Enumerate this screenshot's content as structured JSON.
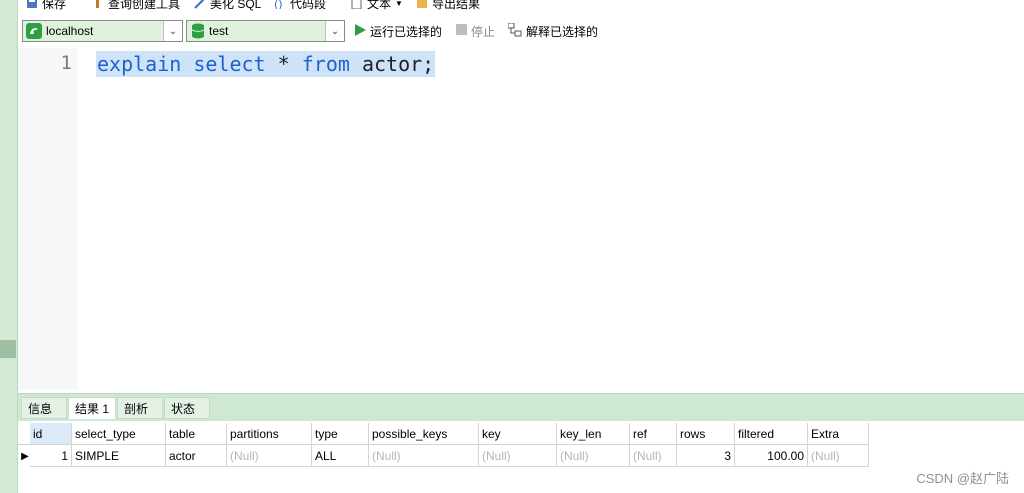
{
  "top_toolbar": {
    "save_label": "保存",
    "query_builder_label": "查询创建工具",
    "beautify_label": "美化 SQL",
    "snippet_label": "代码段",
    "text_label": "文本",
    "export_label": "导出结果"
  },
  "connection": {
    "value": "localhost",
    "icon": "mysql-connection-icon",
    "accent": "#2ea043"
  },
  "database": {
    "value": "test",
    "icon": "database-icon",
    "accent": "#2ea043"
  },
  "actions": {
    "run_selected": "运行已选择的",
    "stop": "停止",
    "explain_selected": "解释已选择的"
  },
  "editor": {
    "line_number": "1",
    "tokens": [
      "explain",
      " ",
      "select",
      " ",
      "*",
      " ",
      "from",
      " ",
      "actor;"
    ]
  },
  "result_tabs": [
    "信息",
    "结果 1",
    "剖析",
    "状态"
  ],
  "active_tab": "结果 1",
  "table": {
    "columns": [
      "id",
      "select_type",
      "table",
      "partitions",
      "type",
      "possible_keys",
      "key",
      "key_len",
      "ref",
      "rows",
      "filtered",
      "Extra"
    ],
    "rows": [
      [
        "1",
        "SIMPLE",
        "actor",
        "(Null)",
        "ALL",
        "(Null)",
        "(Null)",
        "(Null)",
        "(Null)",
        "3",
        "100.00",
        "(Null)"
      ]
    ]
  },
  "watermark": "CSDN @赵广陆"
}
